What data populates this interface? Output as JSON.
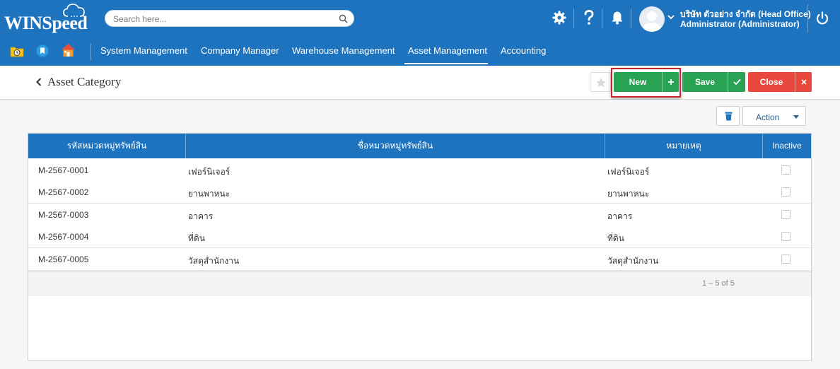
{
  "app": {
    "logo": "WINSpeed"
  },
  "search": {
    "placeholder": "Search here..."
  },
  "user": {
    "company": "บริษัท ตัวอย่าง จำกัด (Head Office)",
    "name": "Administrator (Administrator)"
  },
  "nav": {
    "items": [
      {
        "label": "System Management"
      },
      {
        "label": "Company Manager"
      },
      {
        "label": "Warehouse Management"
      },
      {
        "label": "Asset Management"
      },
      {
        "label": "Accounting"
      }
    ],
    "active": "Asset Management"
  },
  "page": {
    "title": "Asset Category"
  },
  "toolbar": {
    "new_label": "New",
    "save_label": "Save",
    "close_label": "Close",
    "action_label": "Action"
  },
  "table": {
    "columns": [
      "รหัสหมวดหมู่ทรัพย์สิน",
      "ชื่อหมวดหมู่ทรัพย์สิน",
      "หมายเหตุ",
      "Inactive"
    ],
    "rows": [
      {
        "code": "M-2567-0001",
        "name": "เฟอร์นิเจอร์",
        "remark": "เฟอร์นิเจอร์",
        "inactive": false
      },
      {
        "code": "M-2567-0002",
        "name": "ยานพาหนะ",
        "remark": "ยานพาหนะ",
        "inactive": false
      },
      {
        "code": "M-2567-0003",
        "name": "อาคาร",
        "remark": "อาคาร",
        "inactive": false
      },
      {
        "code": "M-2567-0004",
        "name": "ที่ดิน",
        "remark": "ที่ดิน",
        "inactive": false
      },
      {
        "code": "M-2567-0005",
        "name": "วัสดุสำนักงาน",
        "remark": "วัสดุสำนักงาน",
        "inactive": false
      }
    ],
    "pager": "1 – 5 of 5"
  },
  "colors": {
    "primary": "#1e73be",
    "success": "#27a353",
    "danger": "#e8483d",
    "highlight": "#c1272d"
  },
  "icons": [
    "cloud-icon",
    "search-icon",
    "gear-icon",
    "help-icon",
    "bell-icon",
    "avatar-icon",
    "chevron-down-icon",
    "power-icon",
    "folder-clock-icon",
    "bookmark-icon",
    "home-icon",
    "back-arrow-icon",
    "star-icon",
    "plus-icon",
    "check-icon",
    "close-icon",
    "trash-icon",
    "caret-down-icon"
  ]
}
